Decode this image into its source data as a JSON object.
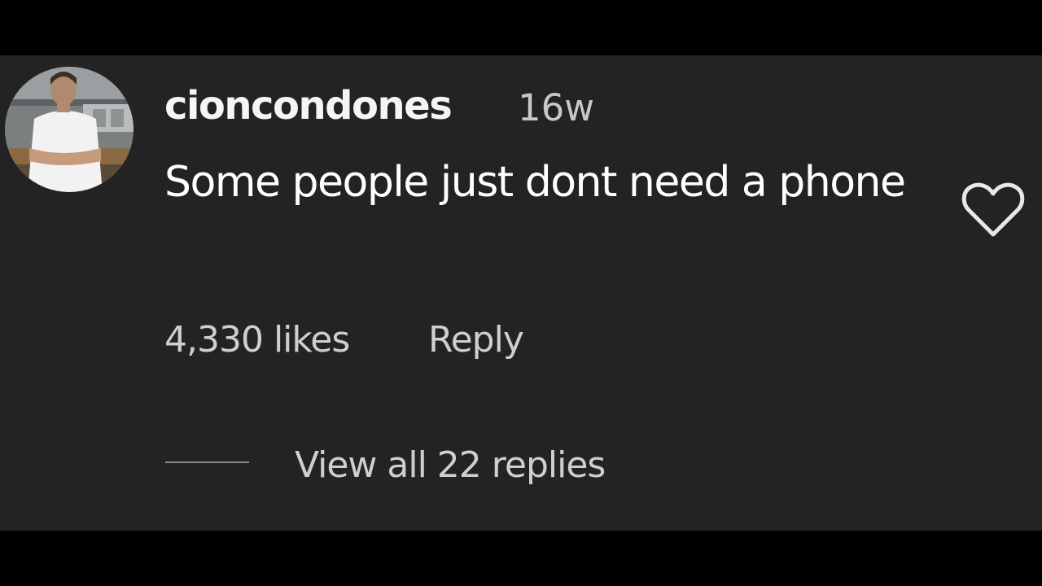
{
  "comment": {
    "username": "cioncondones",
    "timestamp": "16w",
    "text": "Some people just dont need a phone",
    "likes_label": "4,330 likes",
    "reply_label": "Reply",
    "view_replies_label": "View all 22 replies",
    "liked": false
  },
  "icons": {
    "like": "heart-outline-icon",
    "avatar": "profile-photo"
  },
  "colors": {
    "background": "#232323",
    "outer_background": "#000000",
    "primary_text": "#ffffff",
    "secondary_text": "#cfcfcf",
    "divider": "#8a8a8a"
  }
}
